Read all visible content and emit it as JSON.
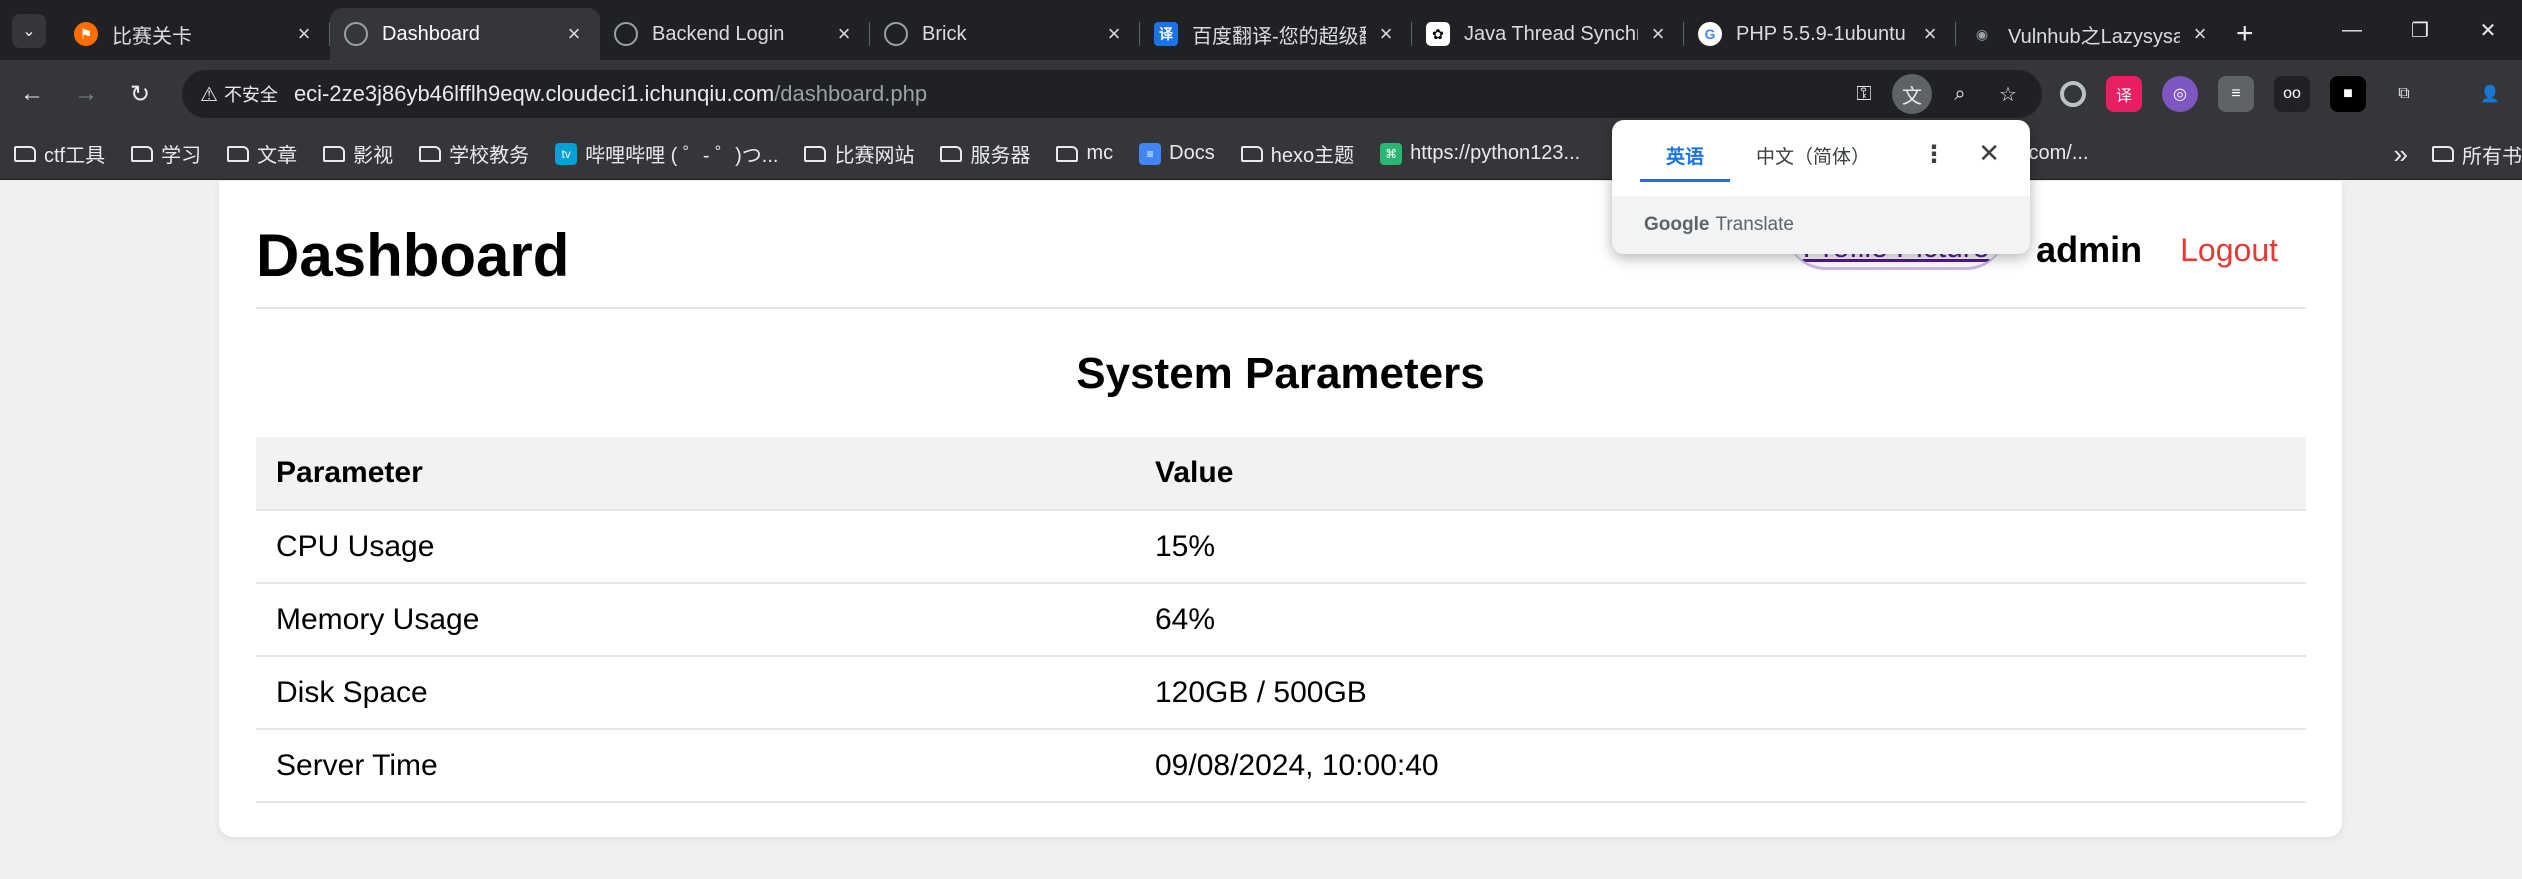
{
  "tabs": [
    {
      "title": "比赛关卡",
      "icon": "flame-icon",
      "color": "#ff6d00",
      "active": false
    },
    {
      "title": "Dashboard",
      "icon": "globe-icon",
      "color": "#9aa0a6",
      "active": true
    },
    {
      "title": "Backend Login",
      "icon": "globe-icon",
      "color": "#9aa0a6",
      "active": false
    },
    {
      "title": "Brick",
      "icon": "globe-icon",
      "color": "#9aa0a6",
      "active": false
    },
    {
      "title": "百度翻译-您的超级翻译伙伴",
      "icon": "translate-icon",
      "color": "#1a73e8",
      "active": false
    },
    {
      "title": "Java Thread Synchronization",
      "icon": "openai-icon",
      "color": "#ffffff",
      "active": false
    },
    {
      "title": "PHP 5.5.9-1ubuntu",
      "icon": "google-icon",
      "color": "#ffffff",
      "active": false
    },
    {
      "title": "Vulnhub之Lazysysadmin",
      "icon": "ghost-icon",
      "color": "#9aa0a6",
      "active": false
    }
  ],
  "toolbar": {
    "security_label": "不安全",
    "url_host": "eci-2ze3j86yb46lfflh9eqw.cloudeci1.ichunqiu.com",
    "url_path": "/dashboard.php"
  },
  "bookmarks": [
    {
      "label": "ctf工具",
      "type": "folder"
    },
    {
      "label": "学习",
      "type": "folder"
    },
    {
      "label": "文章",
      "type": "folder"
    },
    {
      "label": "影视",
      "type": "folder"
    },
    {
      "label": "学校教务",
      "type": "folder"
    },
    {
      "label": "哔哩哔哩 ( ゜- ゜)つ...",
      "type": "site",
      "icon_color": "#00a1d6"
    },
    {
      "label": "比赛网站",
      "type": "folder"
    },
    {
      "label": "服务器",
      "type": "folder"
    },
    {
      "label": "mc",
      "type": "folder"
    },
    {
      "label": "Docs",
      "type": "site",
      "icon_color": "#4285f4"
    },
    {
      "label": "hexo主题",
      "type": "folder"
    },
    {
      "label": "https://python123...",
      "type": "site",
      "icon_color": "#2bb673"
    },
    {
      "label": "login.docker.com/...",
      "type": "site",
      "icon_color": "#1d63ed"
    }
  ],
  "bookmarks_all": "所有书",
  "page": {
    "title": "Dashboard",
    "profile_alt": "Profile Picture",
    "username": "admin",
    "logout": "Logout",
    "section_title": "System Parameters",
    "table": {
      "headers": [
        "Parameter",
        "Value"
      ],
      "rows": [
        [
          "CPU Usage",
          "15%"
        ],
        [
          "Memory Usage",
          "64%"
        ],
        [
          "Disk Space",
          "120GB / 500GB"
        ],
        [
          "Server Time",
          "09/08/2024, 10:00:40"
        ]
      ]
    }
  },
  "translate_popup": {
    "source_lang": "英语",
    "target_lang": "中文（简体）",
    "footer_brand": "Google",
    "footer_label": "Translate"
  }
}
